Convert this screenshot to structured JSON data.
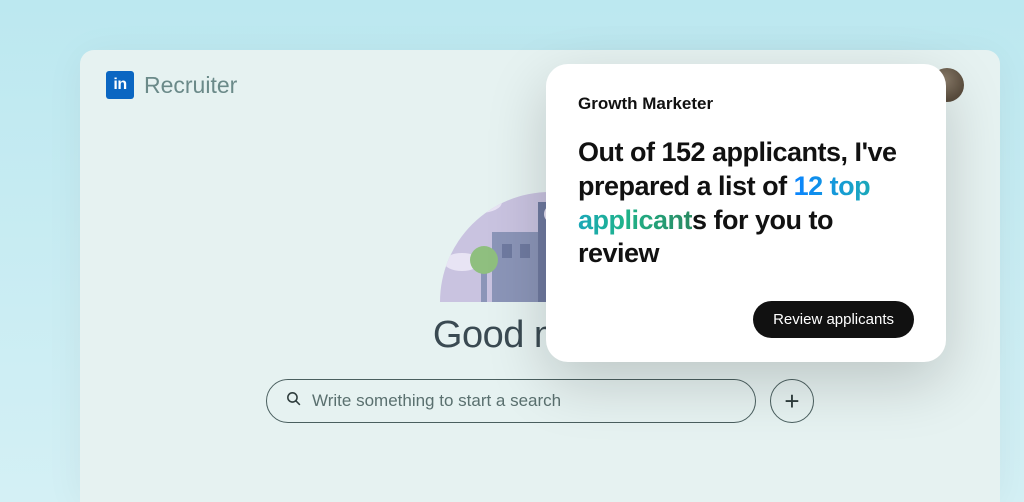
{
  "brand": {
    "logo_text": "in",
    "name": "Recruiter"
  },
  "greeting": "Good mornin",
  "search": {
    "placeholder": "Write something to start a search"
  },
  "add_button": {
    "glyph": "+"
  },
  "card": {
    "title": "Growth Marketer",
    "headline_pre": "Out of 152 applicants, I've prepared a list of ",
    "headline_highlight": "12 top applicant",
    "headline_post": "s for you to review",
    "cta": "Review applicants"
  }
}
